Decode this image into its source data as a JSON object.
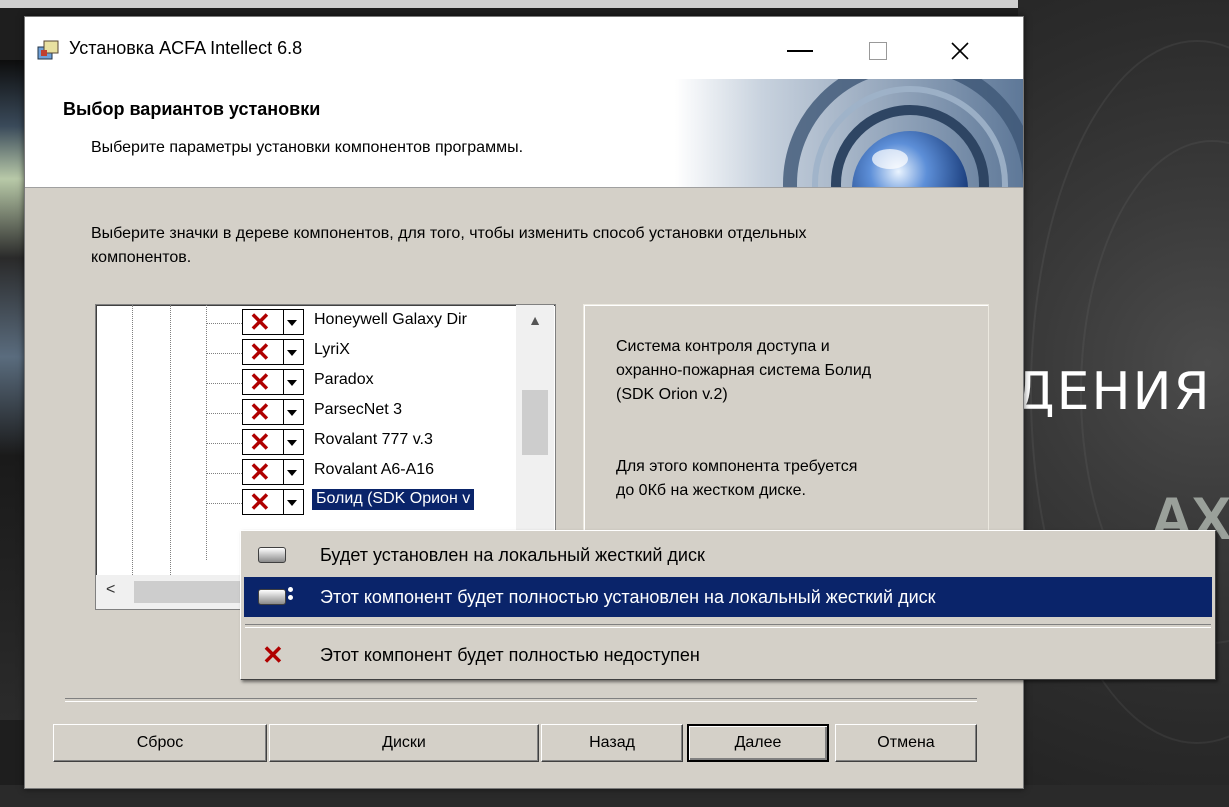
{
  "window": {
    "title": "Установка ACFA Intellect 6.8",
    "header_title": "Выбор вариантов установки",
    "header_subtitle": "Выберите параметры установки компонентов программы."
  },
  "description": "Выберите значки в дереве компонентов, для того, чтобы изменить способ установки отдельных компонентов.",
  "tree": {
    "items": [
      {
        "label": "Honeywell Galaxy Dir",
        "state_icon": "x-icon"
      },
      {
        "label": "LyriX",
        "state_icon": "x-icon"
      },
      {
        "label": "Paradox",
        "state_icon": "x-icon"
      },
      {
        "label": "ParsecNet 3",
        "state_icon": "x-icon"
      },
      {
        "label": "Rovalant 777 v.3",
        "state_icon": "x-icon"
      },
      {
        "label": "Rovalant A6-A16",
        "state_icon": "x-icon"
      },
      {
        "label": "Болид (SDK Орион v",
        "state_icon": "x-icon",
        "selected": true
      }
    ]
  },
  "info": {
    "description": "Система контроля доступа и\nохранно-пожарная система Болид\n(SDK Orion v.2)",
    "size_note": "Для этого компонента требуется\nдо 0Кб на жестком диске."
  },
  "context_menu": {
    "items": [
      {
        "label": "Будет установлен на локальный жесткий диск",
        "icon": "disk-icon"
      },
      {
        "label": "Этот компонент будет полностью установлен на локальный жесткий диск",
        "icon": "disk-full-icon",
        "highlighted": true
      },
      {
        "label": "Этот компонент будет полностью недоступен",
        "icon": "x-icon"
      }
    ]
  },
  "buttons": {
    "reset": "Сброс",
    "disks": "Диски",
    "back": "Назад",
    "next": "Далее",
    "cancel": "Отмена"
  },
  "background": {
    "word": "ДЕНИЯ",
    "word2": "AX"
  },
  "colors": {
    "selection": "#0a246a",
    "dialog_face": "#d4d0c8",
    "x_mark": "#b00000"
  }
}
